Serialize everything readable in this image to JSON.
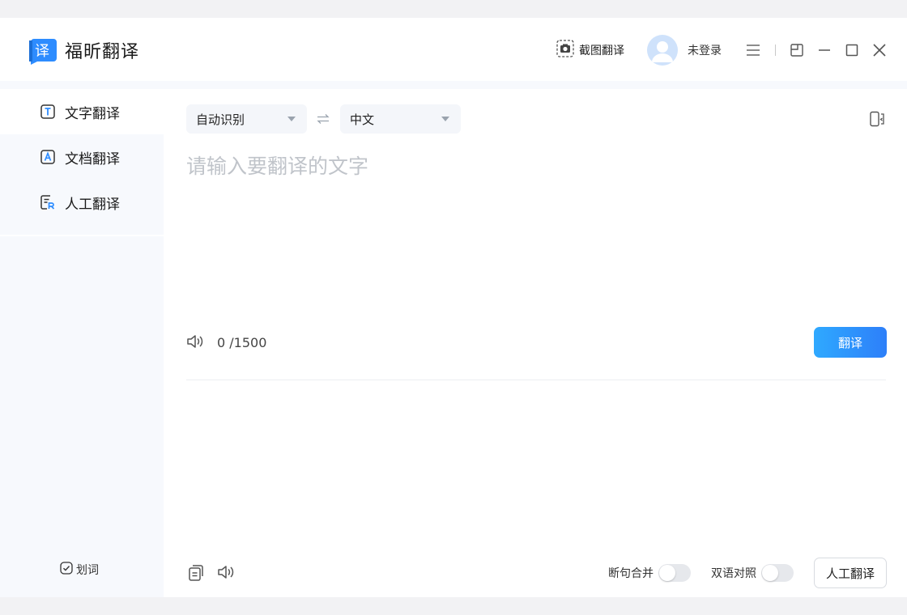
{
  "app": {
    "title": "福昕翻译",
    "logo_glyph": "译"
  },
  "titlebar": {
    "screenshot_translate": "截图翻译",
    "login_status": "未登录"
  },
  "sidebar": {
    "items": [
      {
        "label": "文字翻译",
        "icon": "text-translate-icon",
        "glyph": "T",
        "active": true
      },
      {
        "label": "文档翻译",
        "icon": "document-translate-icon",
        "glyph": "A",
        "active": false
      },
      {
        "label": "人工翻译",
        "icon": "human-translate-icon",
        "glyph": "R",
        "active": false
      }
    ],
    "word_pick_label": "划词",
    "word_pick_checked": true
  },
  "translator": {
    "source_lang": "自动识别",
    "target_lang": "中文",
    "input_placeholder": "请输入要翻译的文字",
    "input_value": "",
    "char_count": "0 /1500",
    "translate_button": "翻译",
    "options": {
      "sentence_merge": {
        "label": "断句合并",
        "enabled": false
      },
      "bilingual": {
        "label": "双语对照",
        "enabled": false
      }
    },
    "human_translate_button": "人工翻译"
  },
  "colors": {
    "accent": "#2d8cff",
    "logo": "#2d8cff",
    "sidebar_bg": "#f7f9fd",
    "placeholder": "#c0c4ca"
  }
}
